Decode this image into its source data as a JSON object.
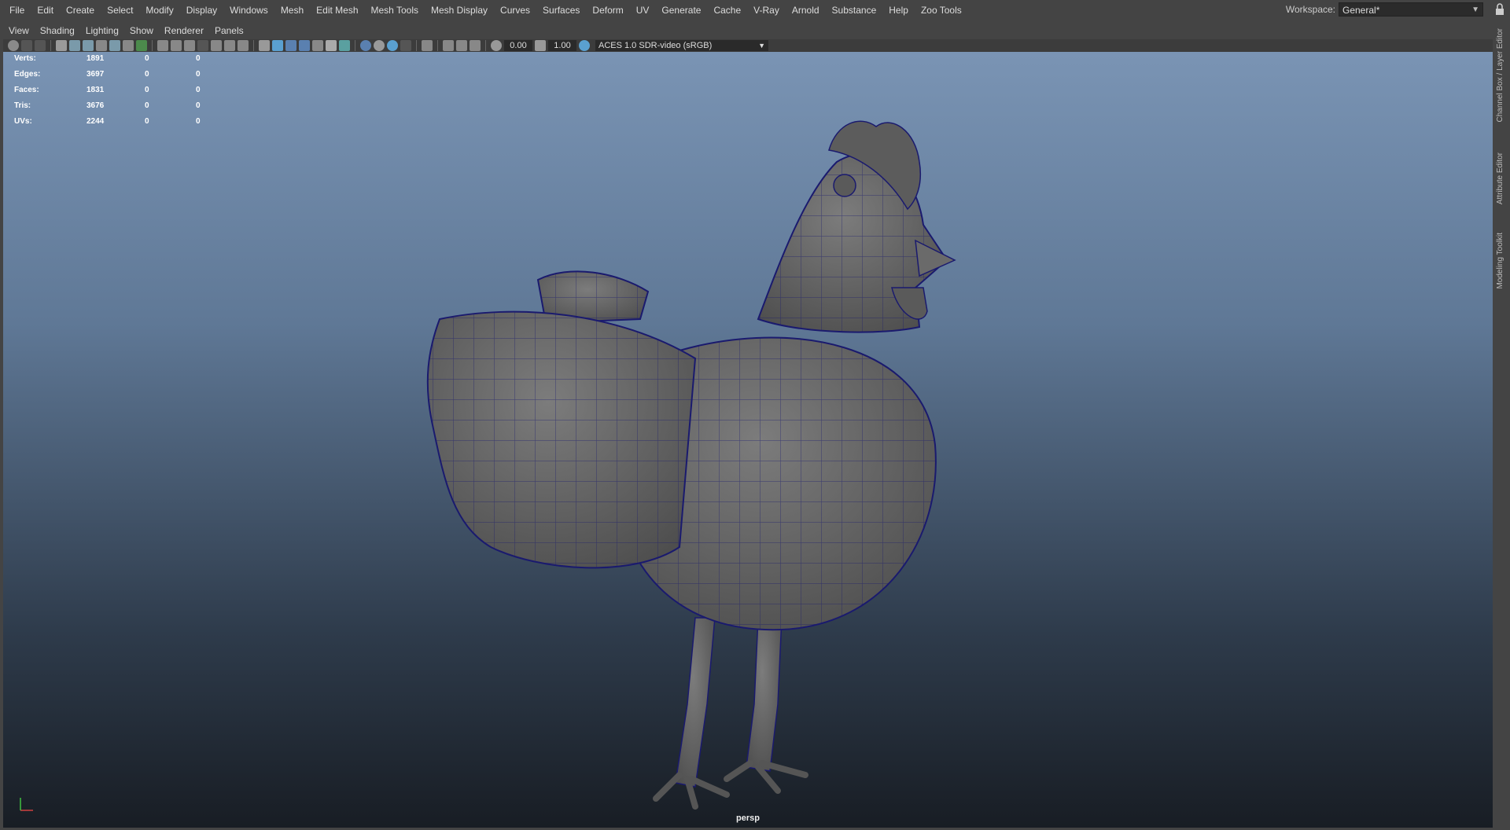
{
  "menubar": {
    "items": [
      "File",
      "Edit",
      "Create",
      "Select",
      "Modify",
      "Display",
      "Windows",
      "Mesh",
      "Edit Mesh",
      "Mesh Tools",
      "Mesh Display",
      "Curves",
      "Surfaces",
      "Deform",
      "UV",
      "Generate",
      "Cache",
      "V-Ray",
      "Arnold",
      "Substance",
      "Help",
      "Zoo Tools"
    ]
  },
  "workspace": {
    "label": "Workspace:",
    "value": "General*"
  },
  "panel_menu": {
    "items": [
      "View",
      "Shading",
      "Lighting",
      "Show",
      "Renderer",
      "Panels"
    ]
  },
  "toolbar": {
    "field1": "0.00",
    "field2": "1.00",
    "color_space": "ACES 1.0 SDR-video (sRGB)"
  },
  "hud": {
    "rows": [
      {
        "label": "Verts:",
        "v1": "1891",
        "v2": "0",
        "v3": "0"
      },
      {
        "label": "Edges:",
        "v1": "3697",
        "v2": "0",
        "v3": "0"
      },
      {
        "label": "Faces:",
        "v1": "1831",
        "v2": "0",
        "v3": "0"
      },
      {
        "label": "Tris:",
        "v1": "3676",
        "v2": "0",
        "v3": "0"
      },
      {
        "label": "UVs:",
        "v1": "2244",
        "v2": "0",
        "v3": "0"
      }
    ]
  },
  "viewport": {
    "camera": "persp"
  },
  "side_tabs": [
    "Channel Box / Layer Editor",
    "Attribute Editor",
    "Modeling Toolkit"
  ],
  "colors": {
    "wire": "#1a1a6e",
    "mesh": "#6a6a6a",
    "accent": "#4aa0d8"
  }
}
